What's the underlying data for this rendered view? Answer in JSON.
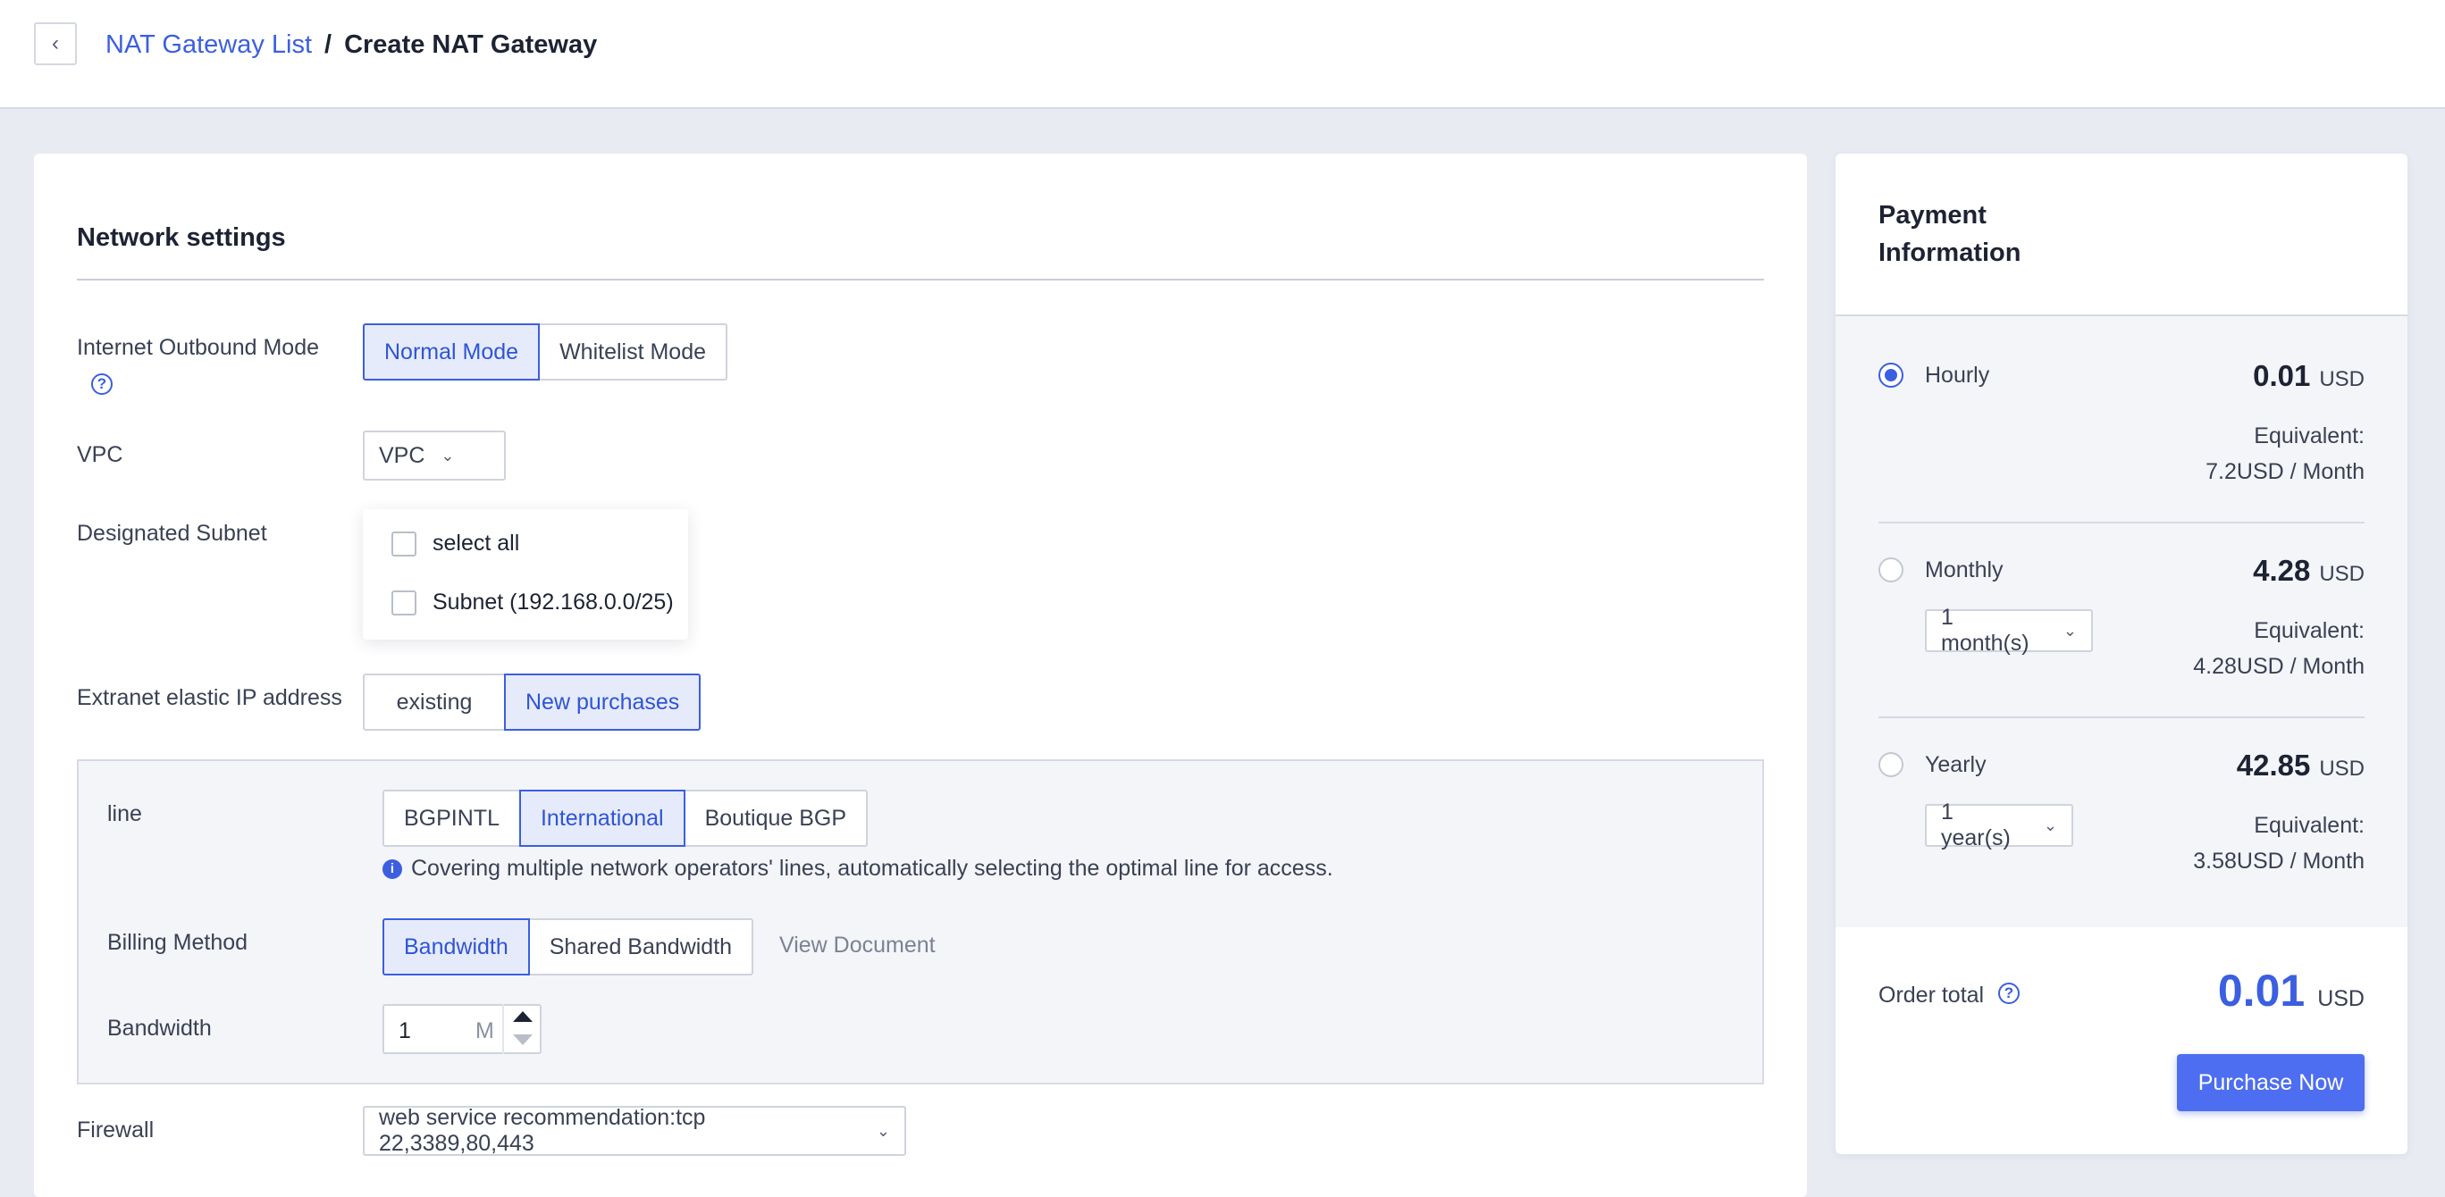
{
  "header": {
    "breadcrumb_link": "NAT Gateway List",
    "separator": "/",
    "current": "Create NAT Gateway"
  },
  "network": {
    "title": "Network settings",
    "outbound_label": "Internet Outbound Mode",
    "outbound_help": "?",
    "outbound_options": [
      "Normal Mode",
      "Whitelist Mode"
    ],
    "outbound_selected": "Normal Mode",
    "vpc_label": "VPC",
    "vpc_value": "VPC",
    "subnet_label": "Designated Subnet",
    "subnet_options": [
      "select all",
      "Subnet (192.168.0.0/25)"
    ],
    "eip_label": "Extranet elastic IP address",
    "eip_options": [
      "existing",
      "New purchases"
    ],
    "eip_selected": "New purchases",
    "line_label": "line",
    "line_options": [
      "BGPINTL",
      "International",
      "Boutique BGP"
    ],
    "line_selected": "International",
    "line_info": "Covering multiple network operators' lines, automatically selecting the optimal line for access.",
    "billing_label": "Billing Method",
    "billing_options": [
      "Bandwidth",
      "Shared Bandwidth"
    ],
    "billing_selected": "Bandwidth",
    "billing_link": "View Document",
    "bandwidth_label": "Bandwidth",
    "bandwidth_value": "1",
    "bandwidth_unit": "M",
    "firewall_label": "Firewall",
    "firewall_value": "web service recommendation:tcp 22,3389,80,443"
  },
  "payment": {
    "title_line1": "Payment",
    "title_line2": "Information",
    "options": [
      {
        "label": "Hourly",
        "price": "0.01",
        "currency": "USD",
        "equiv_label": "Equivalent:",
        "equiv_value": "7.2USD / Month",
        "selected": true
      },
      {
        "label": "Monthly",
        "price": "4.28",
        "currency": "USD",
        "duration": "1 month(s)",
        "equiv_label": "Equivalent:",
        "equiv_value": "4.28USD / Month",
        "selected": false
      },
      {
        "label": "Yearly",
        "price": "42.85",
        "currency": "USD",
        "duration": "1 year(s)",
        "equiv_label": "Equivalent:",
        "equiv_value": "3.58USD / Month",
        "selected": false
      }
    ],
    "order_total_label": "Order total",
    "order_total_value": "0.01",
    "order_total_currency": "USD",
    "purchase_label": "Purchase Now"
  },
  "colors": {
    "accent": "#3b5fe0",
    "background": "#e8ebf2",
    "active_bg": "#e6ebfc"
  },
  "icons": {
    "back": "chevron-left-icon",
    "help": "question-circle-icon",
    "info": "info-circle-icon",
    "dropdown": "chevron-down-icon"
  }
}
